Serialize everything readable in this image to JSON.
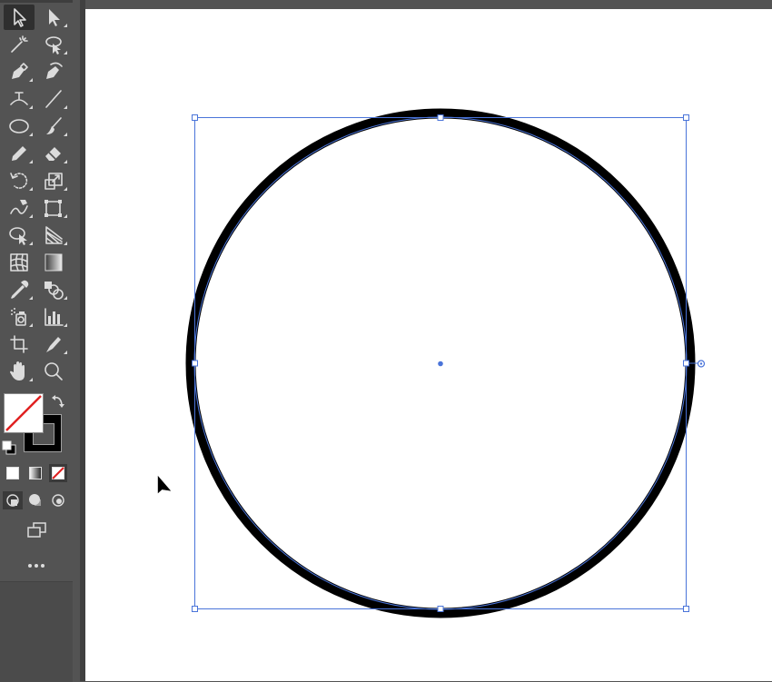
{
  "app": {
    "toolbar": {
      "tools": [
        {
          "name": "selection-tool",
          "icon": "selection-arrow-icon",
          "active": true
        },
        {
          "name": "direct-selection-tool",
          "icon": "direct-selection-arrow-icon"
        },
        {
          "name": "magic-wand-tool",
          "icon": "magic-wand-icon"
        },
        {
          "name": "lasso-tool",
          "icon": "lasso-icon"
        },
        {
          "name": "pen-tool",
          "icon": "pen-icon"
        },
        {
          "name": "curvature-tool",
          "icon": "curvature-pen-icon"
        },
        {
          "name": "type-tool",
          "icon": "type-on-path-icon"
        },
        {
          "name": "line-segment-tool",
          "icon": "line-segment-icon"
        },
        {
          "name": "ellipse-tool",
          "icon": "ellipse-icon"
        },
        {
          "name": "paintbrush-tool",
          "icon": "paintbrush-icon"
        },
        {
          "name": "pencil-tool",
          "icon": "pencil-icon"
        },
        {
          "name": "eraser-tool",
          "icon": "eraser-icon"
        },
        {
          "name": "rotate-tool",
          "icon": "rotate-icon"
        },
        {
          "name": "scale-tool",
          "icon": "scale-icon"
        },
        {
          "name": "warp-tool",
          "icon": "warp-icon"
        },
        {
          "name": "free-transform-tool",
          "icon": "free-transform-icon"
        },
        {
          "name": "shape-builder-tool",
          "icon": "shape-builder-icon"
        },
        {
          "name": "perspective-grid-tool",
          "icon": "perspective-grid-icon"
        },
        {
          "name": "mesh-tool",
          "icon": "mesh-icon"
        },
        {
          "name": "gradient-tool",
          "icon": "gradient-icon"
        },
        {
          "name": "eyedropper-tool",
          "icon": "eyedropper-icon"
        },
        {
          "name": "blend-tool",
          "icon": "blend-icon"
        },
        {
          "name": "symbol-sprayer-tool",
          "icon": "symbol-sprayer-icon"
        },
        {
          "name": "column-graph-tool",
          "icon": "column-graph-icon"
        },
        {
          "name": "artboard-tool",
          "icon": "artboard-icon"
        },
        {
          "name": "slice-tool",
          "icon": "slice-icon"
        },
        {
          "name": "hand-tool",
          "icon": "hand-icon"
        },
        {
          "name": "zoom-tool",
          "icon": "zoom-icon"
        }
      ],
      "fill_color": "#ffffff",
      "fill_none_slash_color": "#e02020",
      "stroke_color": "#000000",
      "color_modes": [
        "color-icon",
        "gradient-icon",
        "none-icon"
      ],
      "draw_modes": [
        "draw-normal-icon",
        "draw-behind-icon",
        "draw-inside-icon"
      ],
      "screen_mode_icon": "screen-mode-icon",
      "more_tools_icon": "more-tools-icon"
    },
    "canvas": {
      "artboard_color": "#ffffff",
      "object": {
        "type": "ellipse",
        "stroke_color": "#000000",
        "selection_color": "#4a74d9"
      }
    }
  }
}
